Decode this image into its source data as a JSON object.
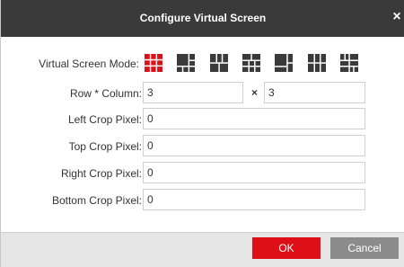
{
  "dialog": {
    "title": "Configure Virtual Screen",
    "close_symbol": "×"
  },
  "mode": {
    "label": "Virtual Screen Mode:",
    "options": [
      {
        "name": "grid-3x3-mode-icon",
        "selected": true
      },
      {
        "name": "layout-mode-2-icon",
        "selected": false
      },
      {
        "name": "layout-mode-3-icon",
        "selected": false
      },
      {
        "name": "layout-mode-4-icon",
        "selected": false
      },
      {
        "name": "layout-mode-5-icon",
        "selected": false
      },
      {
        "name": "layout-mode-6-icon",
        "selected": false
      },
      {
        "name": "layout-mode-7-icon",
        "selected": false
      }
    ],
    "selected_color": "#de0f17",
    "icon_color": "#3a3a3a"
  },
  "row_column": {
    "label": "Row * Column:",
    "rows": "3",
    "separator": "×",
    "columns": "3"
  },
  "left_crop": {
    "label": "Left Crop Pixel:",
    "value": "0"
  },
  "top_crop": {
    "label": "Top Crop Pixel:",
    "value": "0"
  },
  "right_crop": {
    "label": "Right Crop Pixel:",
    "value": "0"
  },
  "bottom_crop": {
    "label": "Bottom Crop Pixel:",
    "value": "0"
  },
  "buttons": {
    "ok": "OK",
    "cancel": "Cancel"
  }
}
